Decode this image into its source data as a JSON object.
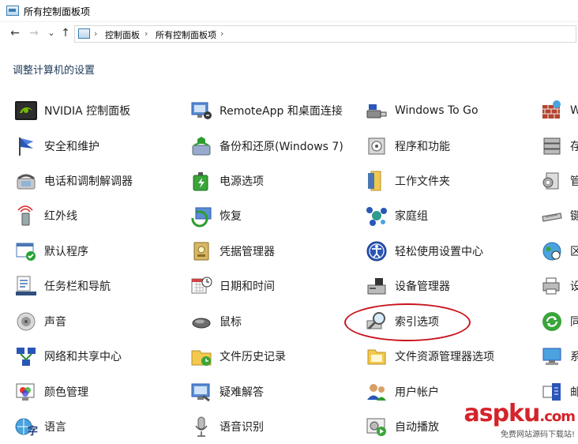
{
  "window": {
    "title": "所有控制面板项"
  },
  "navigation": {
    "back": "←",
    "forward": "→",
    "recent": "⌄",
    "up": "↑",
    "breadcrumb": [
      "控制面板",
      "所有控制面板项"
    ],
    "separator": "›"
  },
  "heading": "调整计算机的设置",
  "columns": [
    [
      {
        "label": "NVIDIA 控制面板",
        "icon": "nvidia-icon"
      },
      {
        "label": "安全和维护",
        "icon": "flag-icon"
      },
      {
        "label": "电话和调制解调器",
        "icon": "telephone-icon"
      },
      {
        "label": "红外线",
        "icon": "infrared-icon"
      },
      {
        "label": "默认程序",
        "icon": "default-programs-icon"
      },
      {
        "label": "任务栏和导航",
        "icon": "taskbar-icon"
      },
      {
        "label": "声音",
        "icon": "speaker-icon"
      },
      {
        "label": "网络和共享中心",
        "icon": "network-icon"
      },
      {
        "label": "颜色管理",
        "icon": "color-management-icon"
      },
      {
        "label": "语言",
        "icon": "language-icon"
      }
    ],
    [
      {
        "label": "RemoteApp 和桌面连接",
        "icon": "remote-desktop-icon"
      },
      {
        "label": "备份和还原(Windows 7)",
        "icon": "backup-icon"
      },
      {
        "label": "电源选项",
        "icon": "power-icon"
      },
      {
        "label": "恢复",
        "icon": "recovery-icon"
      },
      {
        "label": "凭据管理器",
        "icon": "credential-icon"
      },
      {
        "label": "日期和时间",
        "icon": "calendar-clock-icon"
      },
      {
        "label": "鼠标",
        "icon": "mouse-icon"
      },
      {
        "label": "文件历史记录",
        "icon": "file-history-icon"
      },
      {
        "label": "疑难解答",
        "icon": "troubleshoot-icon"
      },
      {
        "label": "语音识别",
        "icon": "microphone-icon"
      }
    ],
    [
      {
        "label": "Windows To Go",
        "icon": "usb-drive-icon"
      },
      {
        "label": "程序和功能",
        "icon": "programs-icon"
      },
      {
        "label": "工作文件夹",
        "icon": "work-folders-icon"
      },
      {
        "label": "家庭组",
        "icon": "homegroup-icon"
      },
      {
        "label": "轻松使用设置中心",
        "icon": "ease-of-access-icon"
      },
      {
        "label": "设备管理器",
        "icon": "device-manager-icon"
      },
      {
        "label": "索引选项",
        "icon": "indexing-icon"
      },
      {
        "label": "文件资源管理器选项",
        "icon": "folder-options-icon"
      },
      {
        "label": "用户帐户",
        "icon": "user-accounts-icon"
      },
      {
        "label": "自动播放",
        "icon": "autoplay-icon"
      }
    ],
    [
      {
        "label": "W",
        "icon": "firewall-icon"
      },
      {
        "label": "存",
        "icon": "storage-icon"
      },
      {
        "label": "管",
        "icon": "admin-tools-icon"
      },
      {
        "label": "键",
        "icon": "keyboard-icon"
      },
      {
        "label": "区",
        "icon": "region-icon"
      },
      {
        "label": "设",
        "icon": "devices-printers-icon"
      },
      {
        "label": "同",
        "icon": "sync-icon"
      },
      {
        "label": "系",
        "icon": "system-icon"
      },
      {
        "label": "邮",
        "icon": "mail-icon"
      },
      {
        "label": "",
        "icon": ""
      }
    ]
  ],
  "watermark": {
    "main": "aspku",
    "suffix": ".com",
    "sub": "免费网站源码下载站!"
  },
  "colors": {
    "heading": "#1e395b",
    "highlight": "#c8141e",
    "watermark": "#d4232a"
  }
}
